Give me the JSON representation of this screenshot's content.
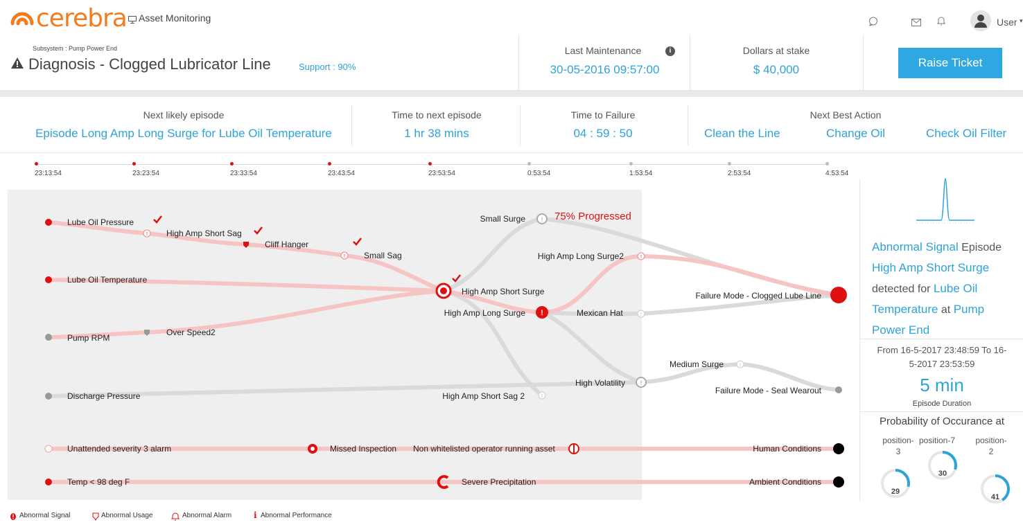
{
  "topbar": {
    "logo_text": "cerebra",
    "app_title": "Asset Monitoring",
    "user_label": "User"
  },
  "header": {
    "subsystem": "Subsystem : Pump Power End",
    "diagnosis": "Diagnosis - Clogged Lubricator Line",
    "support": "Support : 90%",
    "last_maintenance_label": "Last Maintenance",
    "last_maintenance_value": "30-05-2016 09:57:00",
    "dollars_label": "Dollars at stake",
    "dollars_value": "$ 40,000",
    "raise_ticket": "Raise Ticket"
  },
  "kpis": {
    "next_episode_label": "Next likely episode",
    "next_episode_value": "Episode Long Amp Long Surge for Lube Oil Temperature",
    "time_next_label": "Time to next episode",
    "time_next_value": "1 hr 38 mins",
    "time_failure_label": "Time to Failure",
    "time_failure_value": "04 : 59 : 50",
    "nba_label": "Next Best Action",
    "nba_actions": [
      "Clean the Line",
      "Change Oil",
      "Check Oil Filter"
    ]
  },
  "timeline": {
    "ticks": [
      {
        "label": "23:13:54",
        "state": "past"
      },
      {
        "label": "23:23:54",
        "state": "past"
      },
      {
        "label": "23:33:54",
        "state": "past"
      },
      {
        "label": "23:43:54",
        "state": "past"
      },
      {
        "label": "23:53:54",
        "state": "past"
      },
      {
        "label": "0:53:54",
        "state": "future"
      },
      {
        "label": "1:53:54",
        "state": "future"
      },
      {
        "label": "2:53:54",
        "state": "future"
      },
      {
        "label": "4:53:54",
        "state": "future"
      }
    ]
  },
  "graph": {
    "sources": [
      "Lube Oil Pressure",
      "Lube Oil Temperature",
      "Pump RPM",
      "Discharge Pressure",
      "Unattended severity 3 alarm",
      "Temp < 98 deg F"
    ],
    "nodes": {
      "high_amp_short_sag": "High Amp Short Sag",
      "cliff_hanger": "Cliff Hanger",
      "small_sag": "Small Sag",
      "over_speed2": "Over Speed2",
      "high_amp_short_surge": "High Amp Short Surge",
      "small_surge": "Small Surge",
      "progress": "75% Progressed",
      "high_amp_long_surge2": "High Amp Long Surge2",
      "high_amp_long_surge": "High Amp Long Surge",
      "mexican_hat": "Mexican Hat",
      "high_volatility": "High Volatility",
      "high_amp_short_sag_2": "High Amp Short Sag 2",
      "medium_surge": "Medium Surge",
      "missed_inspection": "Missed Inspection",
      "non_whitelisted": "Non whitelisted operator running asset",
      "severe_precipitation": "Severe Precipitation"
    },
    "outcomes": {
      "clogged": "Failure Mode - Clogged Lube Line",
      "seal": "Failure Mode - Seal Wearout",
      "human": "Human Conditions",
      "ambient": "Ambient Conditions"
    }
  },
  "right_panel": {
    "t1": "Abnormal Signal",
    "t2": "Episode",
    "t3": "High Amp Short Surge",
    "t4": "detected for",
    "t5": "Lube Oil",
    "t6": "Temperature",
    "t7": "at",
    "t8": "Pump",
    "t9": "Power End",
    "range_line1": "From 16-5-2017 23:48:59  To 16-",
    "range_line2": "5-2017 23:53:59",
    "duration_value": "5 min",
    "duration_label": "Episode Duration",
    "prob_title": "Probability of Occurance at",
    "gauges": [
      {
        "label1": "position-",
        "label2": "3",
        "value": 29
      },
      {
        "label1": "position-7",
        "label2": "",
        "value": 30
      },
      {
        "label1": "position-",
        "label2": "2",
        "value": 41
      }
    ]
  },
  "legend": [
    "Abnormal Signal",
    "Abnormal Usage",
    "Abnormal Alarm",
    "Abnormal Performance"
  ],
  "colors": {
    "accent": "#2ea3d8",
    "alert": "#e01010",
    "brand": "#f47b20"
  }
}
